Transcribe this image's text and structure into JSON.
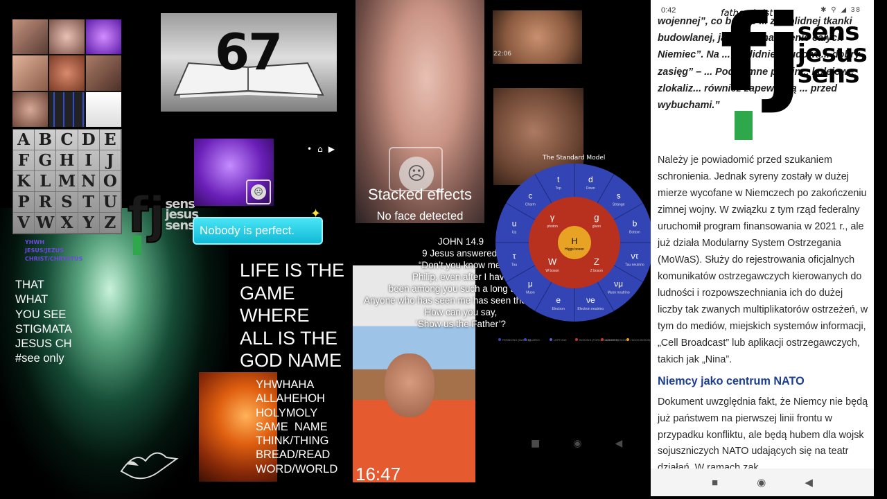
{
  "colors": {
    "accent_green": "#2ea84b",
    "perfect_cyan": "#1fc9e6",
    "link_blue": "#1a3d8f"
  },
  "book": {
    "number": "67"
  },
  "logo": {
    "letter": "fj",
    "words": [
      "sens",
      "jesus",
      "sens"
    ]
  },
  "alphabet": [
    "A",
    "B",
    "C",
    "D",
    "E",
    "F",
    "G",
    "H",
    "I",
    "J",
    "K",
    "L",
    "M",
    "N",
    "O",
    "P",
    "R",
    "S",
    "T",
    "U",
    "V",
    "W",
    "X",
    "Y",
    "Z"
  ],
  "tags": {
    "lines": [
      "YHWH",
      "JESUS/JEZUS",
      "CHRIST/CHRYSTUS"
    ]
  },
  "stigma": {
    "text": "THAT\nWHAT\nYOU SEE\nSTIGMATA\nJESUS CH\n#see only"
  },
  "bubble": {
    "text": "Nobody is perfect."
  },
  "life": {
    "text": "LIFE IS THE\nGAME\nWHERE\nALL IS THE\nGOD NAME"
  },
  "names": {
    "text": "YHWHAHA\nALLAHEHOH\nHOLYMOLY\nSAME  NAME\nTHINK/THING\nBREAD/READ\nWORD/WORLD"
  },
  "effects": {
    "title": "Stacked effects",
    "subtitle": "No face detected"
  },
  "john": {
    "ref": "JOHN 14.9",
    "text": "9 Jesus answered:\n“Don’t you know me,\nPhilip, even after I have\nbeen among you such a long time?\nAnyone who has seen me has seen the Father.\nHow can you say,\n‘Show us the Father’?"
  },
  "selfie": {
    "time": "16:47"
  },
  "clip": {
    "time": "22:06"
  },
  "standard_model": {
    "title": "The Standard Model",
    "center": {
      "symbol": "H",
      "name": "Higgs boson"
    },
    "bosons": [
      {
        "s": "γ",
        "n": "photon"
      },
      {
        "s": "g",
        "n": "gluon"
      },
      {
        "s": "Z",
        "n": "Z boson"
      },
      {
        "s": "W",
        "n": "W boson"
      }
    ],
    "fermions": [
      {
        "s": "d",
        "n": "Down"
      },
      {
        "s": "s",
        "n": "Strange"
      },
      {
        "s": "b",
        "n": "Bottom"
      },
      {
        "s": "ντ",
        "n": "Tau neutrino"
      },
      {
        "s": "νμ",
        "n": "Muon neutrino"
      },
      {
        "s": "νe",
        "n": "Electron neutrino"
      },
      {
        "s": "e",
        "n": "Electron"
      },
      {
        "s": "μ",
        "n": "Muon"
      },
      {
        "s": "τ",
        "n": "Tau"
      },
      {
        "s": "u",
        "n": "Up"
      },
      {
        "s": "c",
        "n": "Charm"
      },
      {
        "s": "t",
        "n": "Top"
      }
    ],
    "legend": [
      "FERMIONS (MATTER)",
      "QUARKS",
      "LEPTONS",
      "BOSONS (FORCE CARRIERS)",
      "GAUGE BOSONS",
      "HIGGS BOSON"
    ]
  },
  "phone": {
    "status_time": "0:42",
    "battery": "38",
    "watermark": "fatherchrist",
    "quote": "wojennej”, co będzie ... z „solidnej tkanki budowlanej, jaka ... je na terenie całych Niemiec”. Na ... „solidnie zbudowa... dobry zasięg” – ... Podziemne parkin... kolejowe zlokaliz... również zapewniają ... przed wybuchami.”",
    "para": "Należy je powiadomić przed szukaniem schronienia. Jednak syreny zostały w dużej mierze wycofane w Niemczech po zakończeniu zimnej wojny. W związku z tym rząd federalny uruchomił program finansowania w 2021 r., ale już działa Modularny System Ostrzegania (MoWaS). Służy do rejestrowania oficjalnych komunikatów ostrzegawczych kierowanych do ludności i rozpowszechniania ich do dużej liczby tak zwanych multiplikatorów ostrzeżeń, w tym do mediów, miejskich systemów informacji, „Cell Broadcast” lub aplikacji ostrzegawczych, takich jak „Nina”.",
    "heading": "Niemcy jako centrum NATO",
    "para2": "Dokument uwzględnia fakt, że Niemcy nie będą już państwem na pierwszej linii frontu w przypadku konfliktu, ale będą hubem dla wojsk sojuszniczych NATO udających się na teatr działań. W ramach zak..."
  }
}
